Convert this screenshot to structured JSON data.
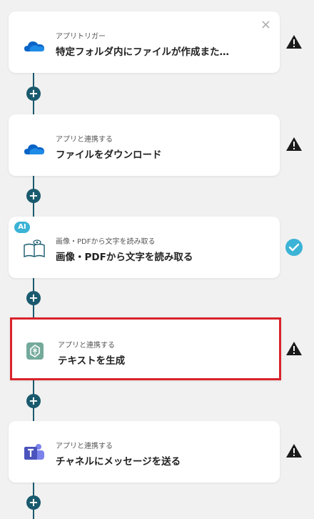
{
  "steps": [
    {
      "subtitle": "アプリトリガー",
      "title": "特定フォルダ内にファイルが作成また…",
      "icon": "onedrive-icon",
      "status": "warning"
    },
    {
      "subtitle": "アプリと連携する",
      "title": "ファイルをダウンロード",
      "icon": "onedrive-icon",
      "status": "warning"
    },
    {
      "subtitle": "画像・PDFから文字を読み取る",
      "title": "画像・PDFから文字を読み取る",
      "icon": "ocr-book-icon",
      "status": "success",
      "badge": "AI"
    },
    {
      "subtitle": "アプリと連携する",
      "title": "テキストを生成",
      "icon": "chatgpt-icon",
      "status": "warning",
      "selected": true
    },
    {
      "subtitle": "アプリと連携する",
      "title": "チャネルにメッセージを送る",
      "icon": "teams-icon",
      "status": "warning"
    }
  ],
  "add_label": "+",
  "close_label": "×",
  "colors": {
    "accent": "#1a5a6e",
    "selected": "#d9232b",
    "success": "#3bb3d6",
    "warning": "#1a1a1a"
  }
}
